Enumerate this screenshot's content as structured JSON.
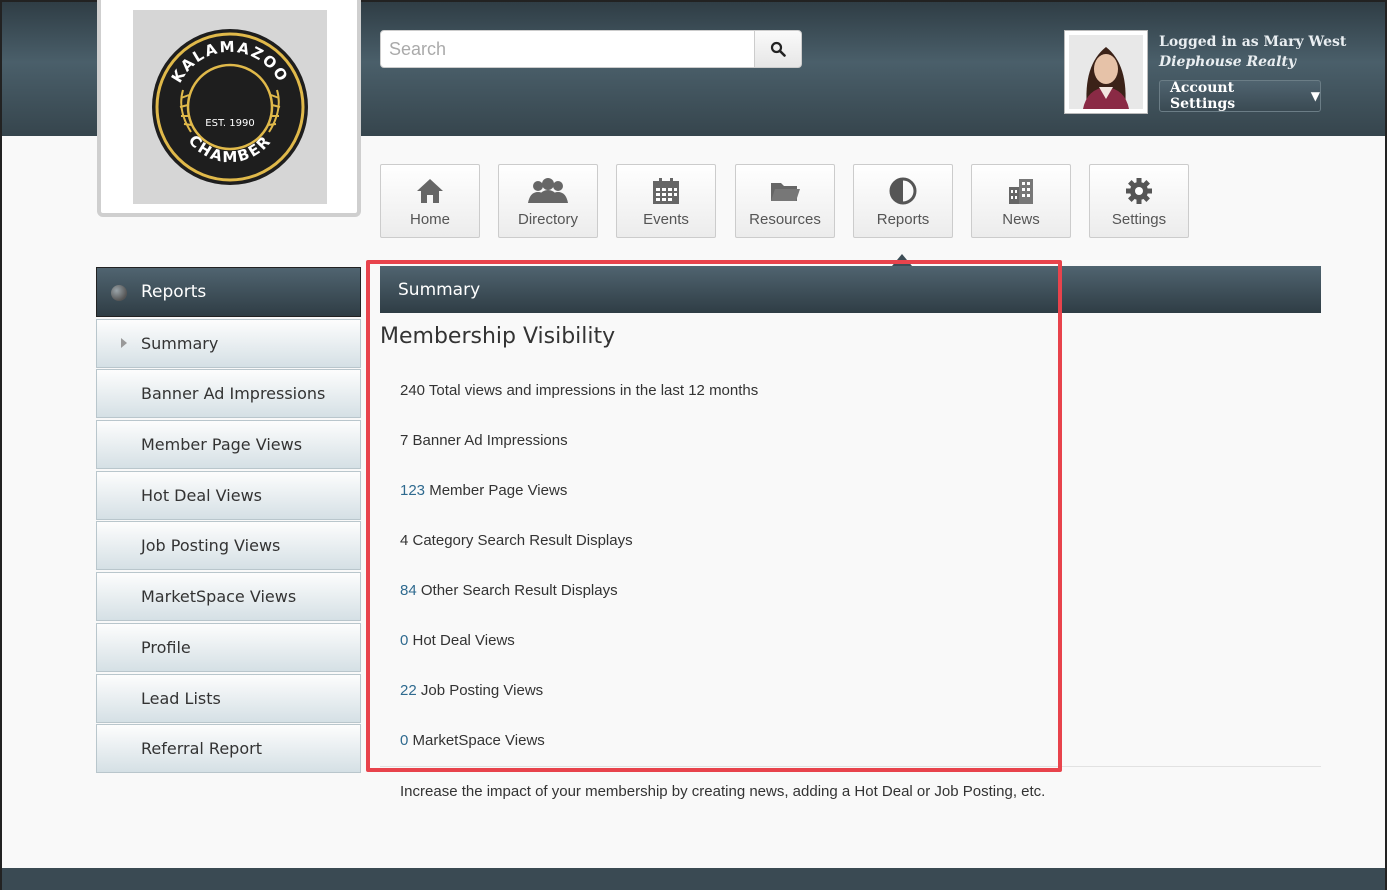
{
  "header": {
    "logo": {
      "org_name": "KALAMAZOO",
      "org_type": "CHAMBER",
      "est": "EST. 1990"
    },
    "search": {
      "placeholder": "Search"
    },
    "user": {
      "logged_in_label": "Logged in as Mary West",
      "company": "Diephouse Realty",
      "account_button": "Account Settings"
    }
  },
  "nav": {
    "items": [
      {
        "label": "Home",
        "icon": "home-icon"
      },
      {
        "label": "Directory",
        "icon": "people-icon"
      },
      {
        "label": "Events",
        "icon": "calendar-icon"
      },
      {
        "label": "Resources",
        "icon": "folder-icon"
      },
      {
        "label": "Reports",
        "icon": "pie-chart-icon",
        "active": true
      },
      {
        "label": "News",
        "icon": "building-icon"
      },
      {
        "label": "Settings",
        "icon": "gear-icon"
      }
    ]
  },
  "sidebar": {
    "title": "Reports",
    "items": [
      {
        "label": "Summary",
        "active": true
      },
      {
        "label": "Banner Ad Impressions"
      },
      {
        "label": "Member Page Views"
      },
      {
        "label": "Hot Deal Views"
      },
      {
        "label": "Job Posting Views"
      },
      {
        "label": "MarketSpace Views"
      },
      {
        "label": "Profile"
      },
      {
        "label": "Lead Lists"
      },
      {
        "label": "Referral Report"
      }
    ]
  },
  "main": {
    "header": "Summary",
    "title": "Membership Visibility",
    "stats": [
      {
        "num": "240",
        "label": " Total views and impressions in the last 12 months",
        "link": false
      },
      {
        "num": "7",
        "label": " Banner Ad Impressions",
        "link": false
      },
      {
        "num": "123",
        "label": " Member Page Views",
        "link": true
      },
      {
        "num": "4",
        "label": " Category Search Result Displays",
        "link": false
      },
      {
        "num": "84",
        "label": " Other Search Result Displays",
        "link": true
      },
      {
        "num": "0",
        "label": " Hot Deal Views",
        "link": true
      },
      {
        "num": "22",
        "label": " Job Posting Views",
        "link": true
      },
      {
        "num": "0",
        "label": " MarketSpace Views",
        "link": true
      }
    ],
    "footer_note": "Increase the impact of your membership by creating news, adding a Hot Deal or Job Posting, etc."
  },
  "colors": {
    "highlight": "#e8434c",
    "header_dark": "#2f3d45",
    "link": "#2f6a8f"
  }
}
